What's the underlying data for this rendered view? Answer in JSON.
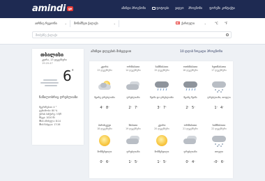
{
  "header": {
    "logo": "amindi",
    "logo_tag": "ge",
    "nav": [
      "ამინდი პროგნოზი",
      "ფოტოები",
      "ვიდეო",
      "პროგნოზი",
      "ფორუმი",
      "კონტაქტი"
    ]
  },
  "search": {
    "region_select": "აირჩიე რეგიონი",
    "city_select": "მონიშნეთ ქალაქი",
    "language": "ქართული",
    "unit_c": "°C",
    "unit_f": "°F",
    "placeholder": "მოძებნე ქალაქი"
  },
  "current": {
    "city": "თბილისი",
    "day": "კვირა, 13 დეკემბერი",
    "time": "19:20:47",
    "temp": "6",
    "temp_unit": "°",
    "description": "ნაწილობრივ ღრუბლიანი",
    "details": [
      "შეგრძნებით: 4 °",
      "ტენიანობა: 80 %",
      "ქარის სიჩქარე: 3 მ/წ",
      "წნევა: 1020 მბ",
      "მზის ამოსვლა: 8:14",
      "მზის ჩასვლა: 17:26"
    ]
  },
  "forecast": {
    "title": "ამინდი დღეების მიხედვით",
    "link": "10 დღის ზოგადი პროგნოზი",
    "days": [
      {
        "name": "კვირა",
        "date": "13 დეკემბერი",
        "icon": "cloud-sun-icon",
        "desc": "მცირე ღრუბლიანი",
        "max": "4",
        "min": "8"
      },
      {
        "name": "ორშაბათი",
        "date": "14 დეკემბერი",
        "icon": "cloudy-icon",
        "desc": "ღრუბლიანი",
        "max": "2",
        "min": "7"
      },
      {
        "name": "სამშაბათი",
        "date": "15 დეკემბერი",
        "icon": "rain-icon",
        "desc": "წვიმა და ღრუბლიანი",
        "max": "3",
        "min": "7"
      },
      {
        "name": "ოთხშაბათი",
        "date": "16 დეკემბერი",
        "icon": "rain-icon",
        "desc": "მცირე წვიმა",
        "max": "2",
        "min": "5"
      },
      {
        "name": "ხუთშაბათი",
        "date": "17 დეკემბერი",
        "icon": "snow-icon",
        "desc": "ღრუბლიანი, თოვლი",
        "max": "1",
        "min": "4"
      },
      {
        "name": "პარასკევი",
        "date": "18 დეკემბერი",
        "icon": "sun-icon",
        "desc": "მოწმენდილი",
        "max": "0",
        "min": "6"
      },
      {
        "name": "შაბათი",
        "date": "19 დეკემბერი",
        "icon": "cloudy-icon",
        "desc": "ღრუბლიანი",
        "max": "1",
        "min": "5"
      },
      {
        "name": "კვირა",
        "date": "20 დეკემბერი",
        "icon": "sun-icon",
        "desc": "მოწმენდილი",
        "max": "1",
        "min": "5"
      },
      {
        "name": "ორშაბათი",
        "date": "21 დეკემბერი",
        "icon": "cloudy-icon",
        "desc": "ღრუბლიანი",
        "max": "0",
        "min": "4"
      },
      {
        "name": "სამშაბათი",
        "date": "22 დეკემბერი",
        "icon": "snow-icon",
        "desc": "თოვლი",
        "max": "-0",
        "min": "6"
      }
    ]
  }
}
